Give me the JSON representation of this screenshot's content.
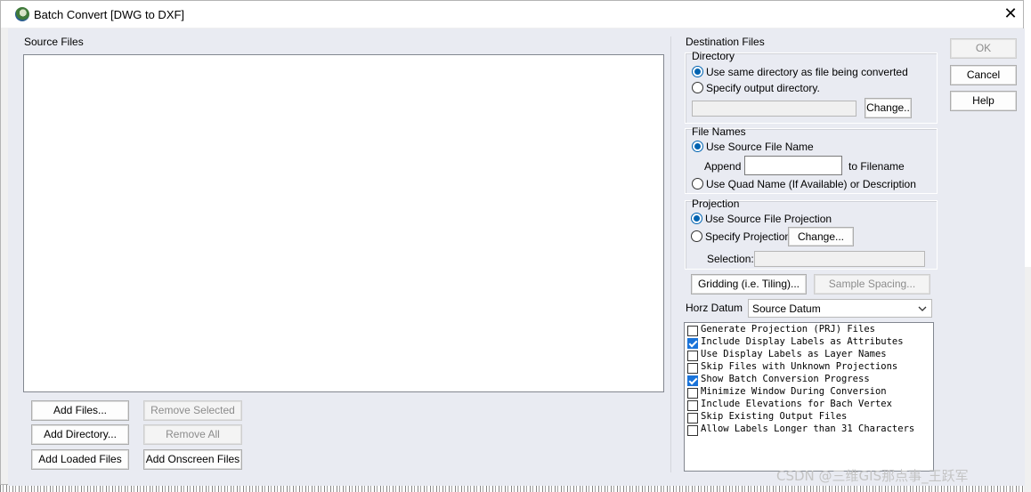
{
  "window": {
    "title": "Batch Convert [DWG to DXF]",
    "close_glyph": "✕"
  },
  "source": {
    "label": "Source Files",
    "buttons": {
      "add_files": "Add Files...",
      "remove_selected": "Remove Selected",
      "add_directory": "Add Directory...",
      "remove_all": "Remove All",
      "add_loaded": "Add Loaded Files",
      "add_onscreen": "Add Onscreen Files"
    }
  },
  "destination": {
    "label": "Destination Files",
    "directory": {
      "label": "Directory",
      "use_same": "Use same directory as file being converted",
      "specify": "Specify output directory.",
      "change": "Change.."
    },
    "file_names": {
      "label": "File Names",
      "use_source": "Use Source File Name",
      "append": "Append",
      "to_filename": "to Filename",
      "use_quad": "Use Quad Name (If Available) or Description"
    },
    "projection": {
      "label": "Projection",
      "use_source": "Use Source File Projection",
      "specify": "Specify Projection",
      "change": "Change...",
      "selection": "Selection:"
    },
    "gridding": "Gridding (i.e. Tiling)...",
    "sample_spacing": "Sample Spacing...",
    "horz_datum": {
      "label": "Horz Datum",
      "value": "Source Datum"
    }
  },
  "options": [
    {
      "label": "Generate Projection (PRJ) Files",
      "checked": false
    },
    {
      "label": "Include Display Labels as Attributes",
      "checked": true
    },
    {
      "label": "Use Display Labels as Layer Names",
      "checked": false
    },
    {
      "label": "Skip Files with Unknown Projections",
      "checked": false
    },
    {
      "label": "Show Batch Conversion Progress",
      "checked": true
    },
    {
      "label": "Minimize Window During Conversion",
      "checked": false
    },
    {
      "label": "Include Elevations for Bach Vertex",
      "checked": false
    },
    {
      "label": "Skip Existing Output Files",
      "checked": false
    },
    {
      "label": "Allow Labels Longer than 31 Characters",
      "checked": false
    }
  ],
  "actions": {
    "ok": "OK",
    "cancel": "Cancel",
    "help": "Help"
  },
  "watermark": "CSDN @三维GIS那点事_王跃军"
}
